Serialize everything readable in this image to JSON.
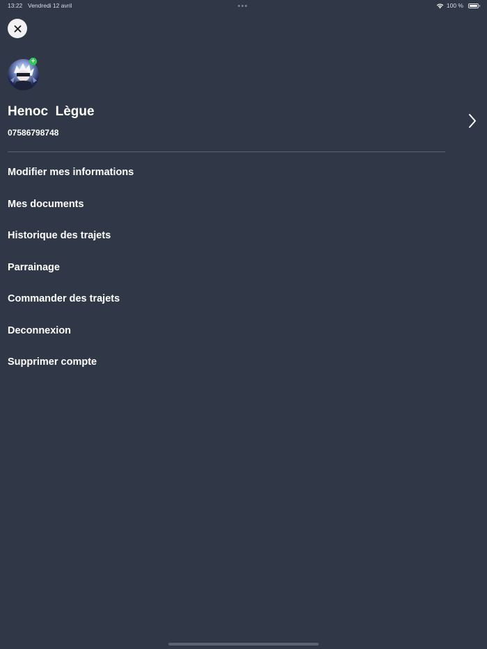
{
  "status_bar": {
    "time": "13:22",
    "date": "Vendredi 12 avril",
    "battery_text": "100 %",
    "wifi_icon": "wifi-icon",
    "battery_icon": "battery-icon"
  },
  "close_button": {
    "icon": "close-icon"
  },
  "profile": {
    "name": "Henoc  Lègue",
    "phone": "07586798748",
    "add_badge_label": "+",
    "chevron_icon": "chevron-right-icon"
  },
  "menu": {
    "items": [
      {
        "label": "Modifier mes informations"
      },
      {
        "label": "Mes documents"
      },
      {
        "label": "Historique des trajets"
      },
      {
        "label": "Parrainage"
      },
      {
        "label": "Commander des trajets"
      },
      {
        "label": "Deconnexion"
      },
      {
        "label": "Supprimer compte"
      }
    ]
  },
  "colors": {
    "background": "#303747",
    "text": "#ffffff",
    "divider": "#5b6272",
    "badge": "#33c759",
    "close_button_bg": "#f2f2f4"
  }
}
